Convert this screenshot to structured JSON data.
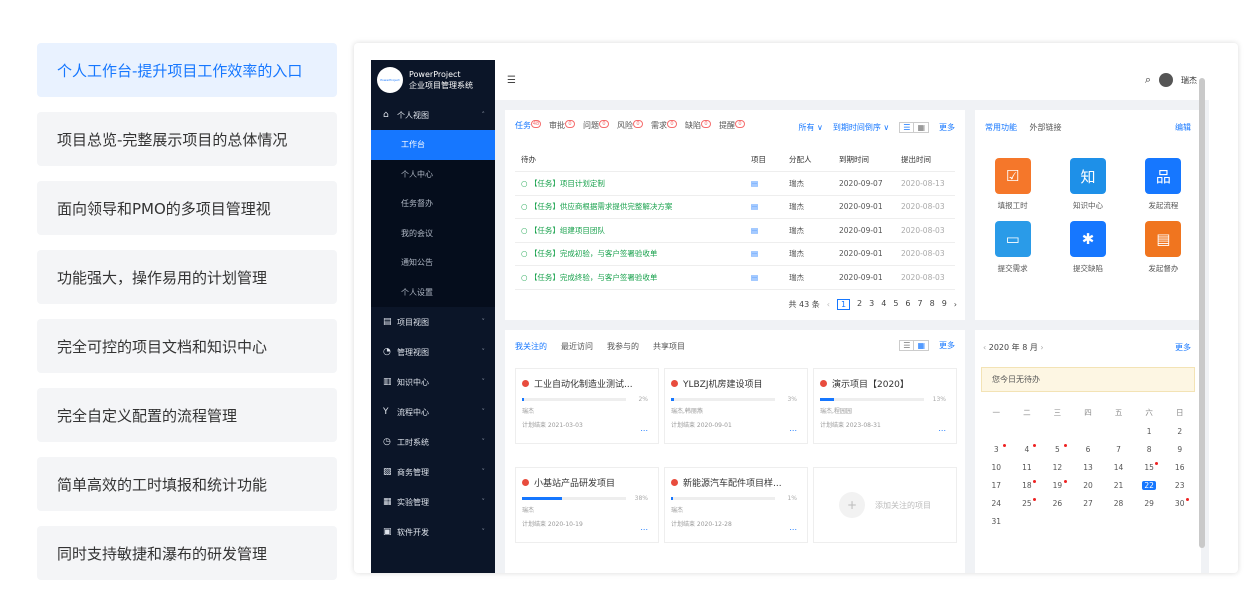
{
  "features": [
    "个人工作台-提升项目工作效率的入口",
    "项目总览-完整展示项目的总体情况",
    "面向领导和PMO的多项目管理视",
    "功能强大，操作易用的计划管理",
    "完全可控的项目文档和知识中心",
    "完全自定义配置的流程管理",
    "简单高效的工时填报和统计功能",
    "同时支持敏捷和瀑布的研发管理"
  ],
  "app": {
    "logo_badge": "PowerProject",
    "logo_line1": "PowerProject",
    "logo_line2": "企业项目管理系统",
    "user": "瑞杰",
    "menu_toggle_icon": "☰",
    "search_icon": "⌕"
  },
  "sidebar": {
    "section": "个人视图",
    "subs": [
      "工作台",
      "个人中心",
      "任务督办",
      "我的会议",
      "通知公告",
      "个人设置"
    ],
    "groups": [
      "项目视图",
      "管理视图",
      "知识中心",
      "流程中心",
      "工时系统",
      "商务管理",
      "实验管理",
      "软件开发"
    ],
    "group_icons": [
      "▤",
      "◔",
      "▥",
      "Y",
      "◷",
      "▧",
      "▦",
      "▣"
    ]
  },
  "todo": {
    "tabs": [
      {
        "label": "任务",
        "count": "48"
      },
      {
        "label": "审批",
        "count": "0"
      },
      {
        "label": "问题",
        "count": "0"
      },
      {
        "label": "风险",
        "count": "0"
      },
      {
        "label": "需求",
        "count": "0"
      },
      {
        "label": "缺陷",
        "count": "0"
      },
      {
        "label": "提醒",
        "count": "0"
      }
    ],
    "filter_all": "所有 ∨",
    "filter_sort": "到期时间倒序 ∨",
    "more": "更多",
    "headers": [
      "待办",
      "项目",
      "分配人",
      "到期时间",
      "提出时间"
    ],
    "rows": [
      {
        "title": "【任务】项目计划定制",
        "assignee": "瑞杰",
        "due": "2020-09-07",
        "created": "2020-08-13"
      },
      {
        "title": "【任务】供应商根据需求提供完整解决方案",
        "assignee": "瑞杰",
        "due": "2020-09-01",
        "created": "2020-08-03"
      },
      {
        "title": "【任务】组建项目团队",
        "assignee": "瑞杰",
        "due": "2020-09-01",
        "created": "2020-08-03"
      },
      {
        "title": "【任务】完成初验，与客户签署验收单",
        "assignee": "瑞杰",
        "due": "2020-09-01",
        "created": "2020-08-03"
      },
      {
        "title": "【任务】完成终验，与客户签署验收单",
        "assignee": "瑞杰",
        "due": "2020-09-01",
        "created": "2020-08-03"
      }
    ],
    "total": "共 43 条",
    "pages": [
      "1",
      "2",
      "3",
      "4",
      "5",
      "6",
      "7",
      "8",
      "9"
    ]
  },
  "quick": {
    "tabs": [
      "常用功能",
      "外部链接"
    ],
    "edit": "编辑",
    "tiles": [
      {
        "label": "填报工时",
        "color": "#f5772a",
        "glyph": "☑"
      },
      {
        "label": "知识中心",
        "color": "#1e90e8",
        "glyph": "知"
      },
      {
        "label": "发起流程",
        "color": "#1677ff",
        "glyph": "品"
      },
      {
        "label": "提交需求",
        "color": "#2a9be8",
        "glyph": "▭"
      },
      {
        "label": "提交缺陷",
        "color": "#1677ff",
        "glyph": "✱"
      },
      {
        "label": "发起督办",
        "color": "#f0751f",
        "glyph": "▤"
      }
    ]
  },
  "projects": {
    "tabs": [
      "我关注的",
      "最近访问",
      "我参与的",
      "共享项目"
    ],
    "more": "更多",
    "items": [
      {
        "name": "工业自动化制造业测试...",
        "progress": 2,
        "pct": "2%",
        "people": "瑞杰",
        "end": "计划结束 2021-03-03"
      },
      {
        "name": "YLBZJ机房建设项目",
        "progress": 3,
        "pct": "3%",
        "people": "瑞杰,韩丽燕",
        "end": "计划结束 2020-09-01"
      },
      {
        "name": "演示项目【2020】",
        "progress": 13,
        "pct": "13%",
        "people": "瑞杰,程园园",
        "end": "计划结束 2023-08-31"
      },
      {
        "name": "小基站产品研发项目",
        "progress": 38,
        "pct": "38%",
        "people": "瑞杰",
        "end": "计划结束 2020-10-19"
      },
      {
        "name": "新能源汽车配件项目样...",
        "progress": 1,
        "pct": "1%",
        "people": "瑞杰",
        "end": "计划结束 2020-12-28"
      }
    ],
    "add_label": "添加关注的项目",
    "dots": "..."
  },
  "calendar": {
    "title": "2020 年 8 月",
    "more": "更多",
    "notice": "您今日无待办",
    "weekdays": [
      "一",
      "二",
      "三",
      "四",
      "五",
      "六",
      "日"
    ],
    "days": [
      "",
      "",
      "",
      "",
      "",
      "1",
      "2",
      "3",
      "4",
      "5",
      "6",
      "7",
      "8",
      "9",
      "10",
      "11",
      "12",
      "13",
      "14",
      "15",
      "16",
      "17",
      "18",
      "19",
      "20",
      "21",
      "22",
      "23",
      "24",
      "25",
      "26",
      "27",
      "28",
      "29",
      "30",
      "31"
    ],
    "marked": [
      "3",
      "4",
      "5",
      "15",
      "18",
      "19",
      "25",
      "30"
    ],
    "today": "22"
  }
}
